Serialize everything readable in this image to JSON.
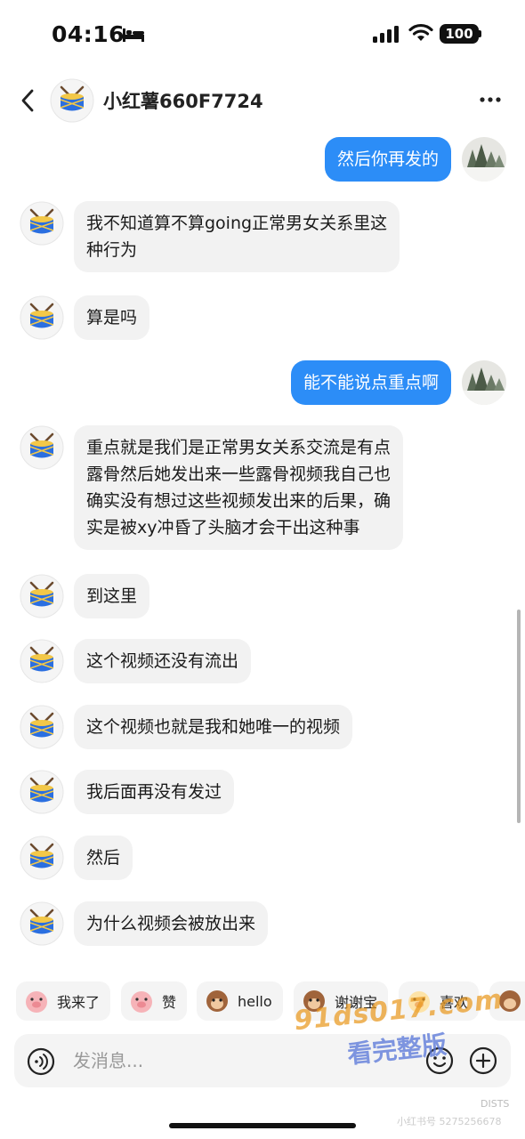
{
  "status_bar": {
    "time": "04:16",
    "battery": "100",
    "icons": [
      "bed-icon",
      "signal-icon",
      "wifi-icon",
      "battery-icon"
    ]
  },
  "header": {
    "title": "小红薯660F7724",
    "back_icon": "chevron-left-icon",
    "more_icon": "more-dots-icon"
  },
  "messages": [
    {
      "from": "self",
      "text": "然后你再发的"
    },
    {
      "from": "other",
      "lines": [
        "我不知道算不算going正常男女关系里这",
        "种行为"
      ]
    },
    {
      "from": "other",
      "lines": [
        "算是吗"
      ]
    },
    {
      "from": "self",
      "text": "能不能说点重点啊"
    },
    {
      "from": "other",
      "lines": [
        "重点就是我们是正常男女关系交流是有点",
        "露骨然后她发出来一些露骨视频我自己也",
        "确实没有想过这些视频发出来的后果，确",
        "实是被xy冲昏了头脑才会干出这种事"
      ]
    },
    {
      "from": "other",
      "lines": [
        "到这里"
      ]
    },
    {
      "from": "other",
      "lines": [
        "这个视频还没有流出"
      ]
    },
    {
      "from": "other",
      "lines": [
        "这个视频也就是我和她唯一的视频"
      ]
    },
    {
      "from": "other",
      "lines": [
        "我后面再没有发过"
      ]
    },
    {
      "from": "other",
      "lines": [
        "然后"
      ]
    },
    {
      "from": "other",
      "lines": [
        "为什么视频会被放出来"
      ]
    }
  ],
  "quick_replies": [
    "我来了",
    "赞",
    "hello",
    "谢谢宝",
    "喜欢"
  ],
  "input": {
    "placeholder": "发消息...",
    "value": ""
  },
  "watermark": {
    "site": "91ds017.com",
    "slogan": "看完整版",
    "tag": "DISTS",
    "small": "小红书号 5275256678"
  },
  "colors": {
    "outgoing_bubble": "#2c8df7",
    "incoming_bubble": "#f2f2f2",
    "drum_blue": "#2b6fe0"
  }
}
